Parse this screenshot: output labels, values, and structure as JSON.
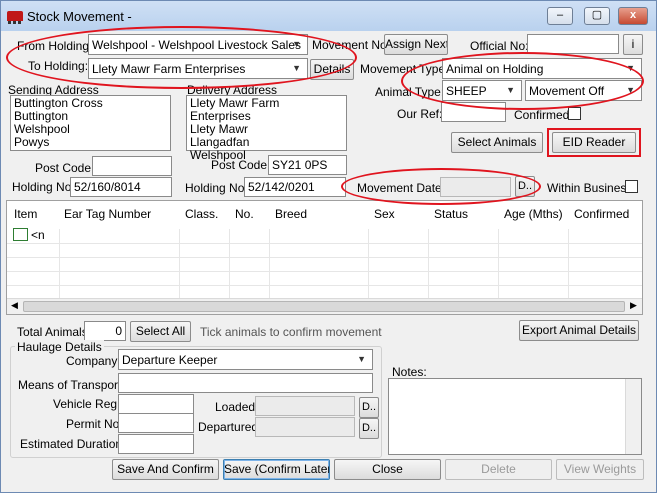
{
  "window": {
    "title": "Stock Movement -",
    "min_label": "–",
    "max_label": "▢",
    "close_label": "x"
  },
  "from_holding": {
    "label": "From Holding:",
    "value": "Welshpool - Welshpool Livestock Sales"
  },
  "to_holding": {
    "label": "To Holding:",
    "value": "Llety Mawr Farm Enterprises",
    "details_label": "Details"
  },
  "movement_no": {
    "label": "Movement No:",
    "assign_label": "Assign Next"
  },
  "official_no": {
    "label": "Official No:",
    "info_label": "i",
    "value": ""
  },
  "movement_type": {
    "label": "Movement Type:",
    "value": "Animal on Holding"
  },
  "animal_type": {
    "label": "Animal Type:",
    "value": "SHEEP",
    "direction": "Movement Off"
  },
  "our_ref": {
    "label": "Our Ref:",
    "value": ""
  },
  "confirmed": {
    "label": "Confirmed:"
  },
  "select_animals_label": "Select Animals",
  "eid_reader_label": "EID Reader",
  "sending": {
    "label": "Sending Address",
    "lines": [
      "Buttington Cross",
      "Buttington",
      "Welshpool",
      "Powys"
    ],
    "postcode_label": "Post Code:",
    "postcode": "",
    "holding_label": "Holding No:",
    "holding": "52/160/8014"
  },
  "delivery": {
    "label": "Delivery Address",
    "lines": [
      "Llety Mawr Farm Enterprises",
      "Llety Mawr",
      "Llangadfan",
      "Welshpool"
    ],
    "postcode_label": "Post Code:",
    "postcode": "SY21 0PS",
    "holding_label": "Holding No:",
    "holding": "52/142/0201"
  },
  "movement_date": {
    "label": "Movement Date:",
    "value": "",
    "picker_label": "D.."
  },
  "within_business": {
    "label": "Within Business"
  },
  "grid": {
    "columns": [
      "Item",
      "Ear Tag Number",
      "Class.",
      "No.",
      "Breed",
      "Sex",
      "Status",
      "Age (Mths)",
      "Confirmed"
    ],
    "new_row_label": "<n"
  },
  "totals": {
    "label": "Total Animals:",
    "value": "0",
    "select_all_label": "Select All",
    "hint": "Tick animals to confirm movement",
    "export_label": "Export Animal Details"
  },
  "haulage": {
    "title": "Haulage Details",
    "company_label": "Company:",
    "company": "Departure Keeper",
    "transport_label": "Means of Transport:",
    "transport": "",
    "vehicle_label": "Vehicle Reg:",
    "vehicle": "",
    "permit_label": "Permit No:",
    "permit": "",
    "duration_label": "Estimated Duration:",
    "duration": "",
    "loaded_label": "Loaded:",
    "loaded": "",
    "departured_label": "Departured:",
    "departured": "",
    "picker_label": "D.."
  },
  "notes": {
    "label": "Notes:",
    "value": ""
  },
  "actions": {
    "save_confirm": "Save And Confirm",
    "save_later": "Save (Confirm Later)",
    "close": "Close",
    "delete": "Delete",
    "view_weights": "View Weights"
  },
  "colors": {
    "annotation_red": "#e0141e",
    "title_bar": "#b9d1ee",
    "focus_blue": "#3c7fb1"
  }
}
